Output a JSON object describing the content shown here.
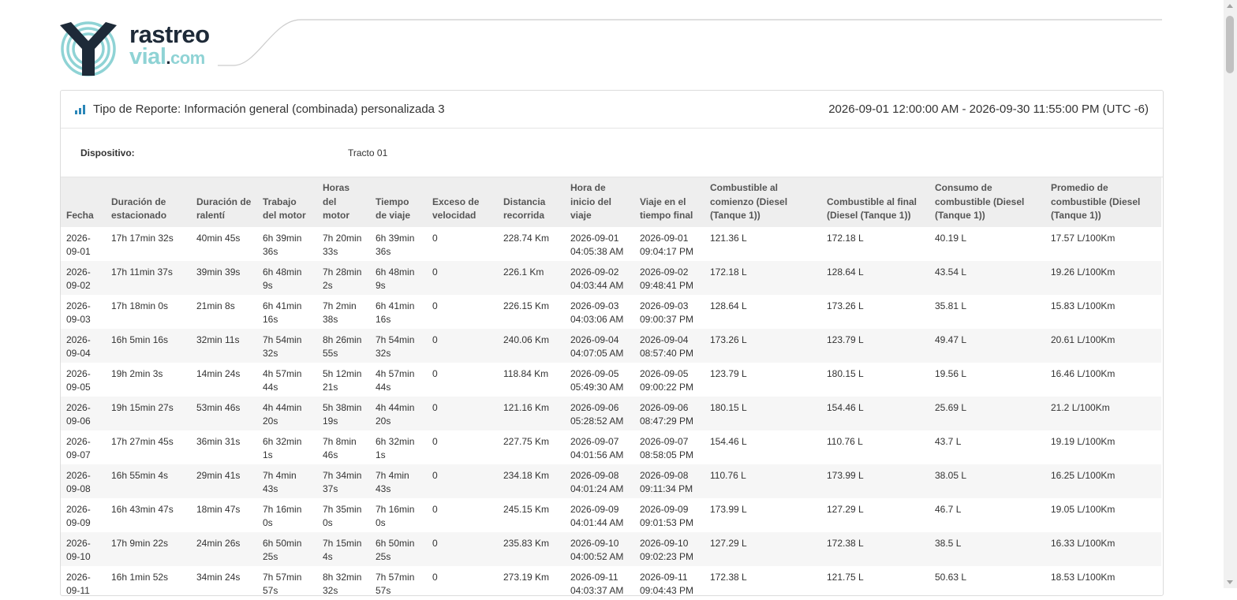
{
  "brand": {
    "name_line1": "rastreo",
    "name_line2": "vial",
    "name_dot": ".",
    "name_com": "com",
    "color_dark": "#1e2a38",
    "color_light": "#8fd3d5"
  },
  "report": {
    "title": "Tipo de Reporte: Información general (combinada) personalizada 3",
    "date_range": "2026-09-01 12:00:00 AM - 2026-09-30 11:55:00 PM (UTC -6)",
    "icon": "bar-chart-icon",
    "accent_color": "#2a86b8"
  },
  "device": {
    "label": "Dispositivo:",
    "value": "Tracto 01"
  },
  "table": {
    "columns": [
      "Fecha",
      "Duración de estacionado",
      "Duración de ralentí",
      "Trabajo del motor",
      "Horas del motor",
      "Tiempo de viaje",
      "Exceso de velocidad",
      "Distancia recorrida",
      "Hora de inicio del viaje",
      "Viaje en el tiempo final",
      "Combustible al comienzo (Diesel (Tanque 1))",
      "Combustible al final (Diesel (Tanque 1))",
      "Consumo de combustible (Diesel (Tanque 1))",
      "Promedio de combustible (Diesel (Tanque 1))"
    ],
    "rows": [
      [
        "2026-09-01",
        "17h 17min 32s",
        "40min 45s",
        "6h 39min 36s",
        "7h 20min 33s",
        "6h 39min 36s",
        "0",
        "228.74 Km",
        "2026-09-01 04:05:38 AM",
        "2026-09-01 09:04:17 PM",
        "121.36 L",
        "172.18 L",
        "40.19 L",
        "17.57 L/100Km"
      ],
      [
        "2026-09-02",
        "17h 11min 37s",
        "39min 39s",
        "6h 48min 9s",
        "7h 28min 2s",
        "6h 48min 9s",
        "0",
        "226.1 Km",
        "2026-09-02 04:03:44 AM",
        "2026-09-02 09:48:41 PM",
        "172.18 L",
        "128.64 L",
        "43.54 L",
        "19.26 L/100Km"
      ],
      [
        "2026-09-03",
        "17h 18min 0s",
        "21min 8s",
        "6h 41min 16s",
        "7h 2min 38s",
        "6h 41min 16s",
        "0",
        "226.15 Km",
        "2026-09-03 04:03:06 AM",
        "2026-09-03 09:00:37 PM",
        "128.64 L",
        "173.26 L",
        "35.81 L",
        "15.83 L/100Km"
      ],
      [
        "2026-09-04",
        "16h 5min 16s",
        "32min 11s",
        "7h 54min 32s",
        "8h 26min 55s",
        "7h 54min 32s",
        "0",
        "240.06 Km",
        "2026-09-04 04:07:05 AM",
        "2026-09-04 08:57:40 PM",
        "173.26 L",
        "123.79 L",
        "49.47 L",
        "20.61 L/100Km"
      ],
      [
        "2026-09-05",
        "19h 2min 3s",
        "14min 24s",
        "4h 57min 44s",
        "5h 12min 21s",
        "4h 57min 44s",
        "0",
        "118.84 Km",
        "2026-09-05 05:49:30 AM",
        "2026-09-05 09:00:22 PM",
        "123.79 L",
        "180.15 L",
        "19.56 L",
        "16.46 L/100Km"
      ],
      [
        "2026-09-06",
        "19h 15min 27s",
        "53min 46s",
        "4h 44min 20s",
        "5h 38min 19s",
        "4h 44min 20s",
        "0",
        "121.16 Km",
        "2026-09-06 05:28:52 AM",
        "2026-09-06 08:47:29 PM",
        "180.15 L",
        "154.46 L",
        "25.69 L",
        "21.2 L/100Km"
      ],
      [
        "2026-09-07",
        "17h 27min 45s",
        "36min 31s",
        "6h 32min 1s",
        "7h 8min 46s",
        "6h 32min 1s",
        "0",
        "227.75 Km",
        "2026-09-07 04:01:56 AM",
        "2026-09-07 08:58:05 PM",
        "154.46 L",
        "110.76 L",
        "43.7 L",
        "19.19 L/100Km"
      ],
      [
        "2026-09-08",
        "16h 55min 4s",
        "29min 41s",
        "7h 4min 43s",
        "7h 34min 37s",
        "7h 4min 43s",
        "0",
        "234.18 Km",
        "2026-09-08 04:01:24 AM",
        "2026-09-08 09:11:34 PM",
        "110.76 L",
        "173.99 L",
        "38.05 L",
        "16.25 L/100Km"
      ],
      [
        "2026-09-09",
        "16h 43min 47s",
        "18min 47s",
        "7h 16min 0s",
        "7h 35min 0s",
        "7h 16min 0s",
        "0",
        "245.15 Km",
        "2026-09-09 04:01:44 AM",
        "2026-09-09 09:01:53 PM",
        "173.99 L",
        "127.29 L",
        "46.7 L",
        "19.05 L/100Km"
      ],
      [
        "2026-09-10",
        "17h 9min 22s",
        "24min 26s",
        "6h 50min 25s",
        "7h 15min 4s",
        "6h 50min 25s",
        "0",
        "235.83 Km",
        "2026-09-10 04:00:52 AM",
        "2026-09-10 09:02:23 PM",
        "127.29 L",
        "172.38 L",
        "38.5 L",
        "16.33 L/100Km"
      ],
      [
        "2026-09-11",
        "16h 1min 52s",
        "34min 24s",
        "7h 57min 57s",
        "8h 32min 32s",
        "7h 57min 57s",
        "0",
        "273.19 Km",
        "2026-09-11 04:03:37 AM",
        "2026-09-11 09:04:43 PM",
        "172.38 L",
        "121.75 L",
        "50.63 L",
        "18.53 L/100Km"
      ]
    ]
  }
}
